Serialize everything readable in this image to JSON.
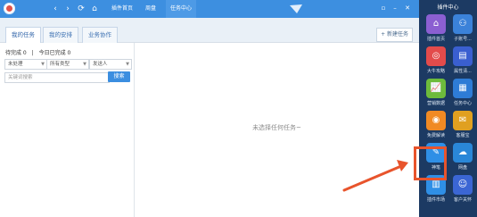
{
  "topbar": {
    "tabs": [
      "插件首页",
      "周盘",
      "任务中心"
    ],
    "active_tab": "任务中心"
  },
  "task_tabs": {
    "items": [
      "我的任务",
      "我的安排",
      "业务协作"
    ],
    "active": "我的任务",
    "new_task_label": "+ 新建任务"
  },
  "filter": {
    "stats_pending": "待完成 0",
    "stats_divider": "|",
    "stats_today": "今日已完成 0",
    "status_select": "未处理",
    "type_select": "所有类型",
    "sender_select": "发送人",
    "keyword_placeholder": "关键词搜索",
    "search_label": "搜索"
  },
  "main": {
    "empty_message": "未选择任何任务~"
  },
  "sidebar": {
    "title": "插件中心",
    "tiles": [
      {
        "label": "插件首页",
        "icon": "home-icon",
        "color": "#8b5fd1"
      },
      {
        "label": "子账号...",
        "icon": "person-icon",
        "color": "#3b82d9"
      },
      {
        "label": "大牛攻略",
        "icon": "strategy-icon",
        "color": "#e34b4b"
      },
      {
        "label": "属性清...",
        "icon": "book-icon",
        "color": "#3a5fd0"
      },
      {
        "label": "营销数据",
        "icon": "chart-icon",
        "color": "#6dbb3c"
      },
      {
        "label": "任务中心",
        "icon": "calendar-icon",
        "color": "#2e7cd6"
      },
      {
        "label": "免费解读",
        "icon": "coin-icon",
        "color": "#f08a24"
      },
      {
        "label": "客服宝",
        "icon": "chat-icon",
        "color": "#e0a020"
      },
      {
        "label": "神笔",
        "icon": "pen-icon",
        "color": "#2f8fe6"
      },
      {
        "label": "网盘",
        "icon": "cloud-icon",
        "color": "#2a87d8"
      },
      {
        "label": "插件市场",
        "icon": "market-icon",
        "color": "#2f8fe6"
      },
      {
        "label": "客户关怀",
        "icon": "care-icon",
        "color": "#3b66d4"
      }
    ]
  }
}
